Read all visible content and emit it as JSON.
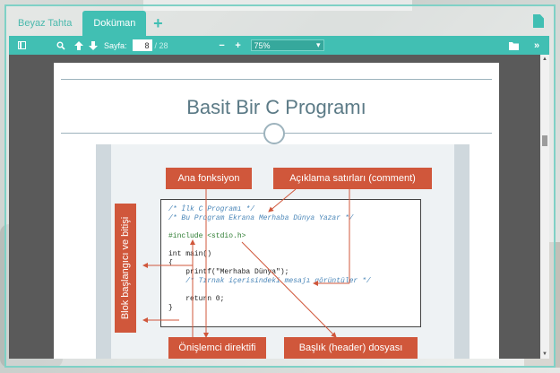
{
  "tabs": [
    {
      "label": "Beyaz Tahta",
      "active": false
    },
    {
      "label": "Doküman",
      "active": true
    }
  ],
  "tab_add_label": "+",
  "toolbar": {
    "page_label": "Sayfa:",
    "page_current": "8",
    "page_total": "/ 28",
    "zoom_minus": "−",
    "zoom_plus": "+",
    "zoom_value": "75%",
    "zoom_caret": "▾",
    "more_label": "»"
  },
  "slide": {
    "title": "Basit Bir C Programı",
    "labels": {
      "ana_fonksiyon": "Ana fonksiyon",
      "aciklama": "Açıklama satırları (comment)",
      "blok": "Blok başlangıcı ve bitişi",
      "onislemci": "Önişlemci direktifi",
      "baslik": "Başlık (header) dosyası"
    },
    "code": [
      {
        "text": "/* İlk C Programı */",
        "kind": "comment"
      },
      {
        "text": "/* Bu Program Ekrana Merhaba Dünya Yazar */",
        "kind": "comment"
      },
      {
        "text": "",
        "kind": "plain"
      },
      {
        "text": "#include <stdio.h>",
        "kind": "pre"
      },
      {
        "text": "",
        "kind": "plain"
      },
      {
        "text": "int main()",
        "kind": "plain"
      },
      {
        "text": "{",
        "kind": "plain"
      },
      {
        "text": "    printf(\"Merhaba Dünya\");",
        "kind": "plain"
      },
      {
        "text": "    /* Tırnak içerisindeki mesajı görüntüler */",
        "kind": "comment"
      },
      {
        "text": "",
        "kind": "plain"
      },
      {
        "text": "    return 0;",
        "kind": "plain"
      },
      {
        "text": "}",
        "kind": "plain"
      }
    ]
  },
  "colors": {
    "accent": "#41bfb3",
    "label_bg": "#d0573b",
    "title_text": "#5b7a86"
  },
  "icons": [
    "sidebar-toggle-icon",
    "search-icon",
    "arrow-up-icon",
    "arrow-down-icon",
    "open-file-icon",
    "document-icon"
  ]
}
